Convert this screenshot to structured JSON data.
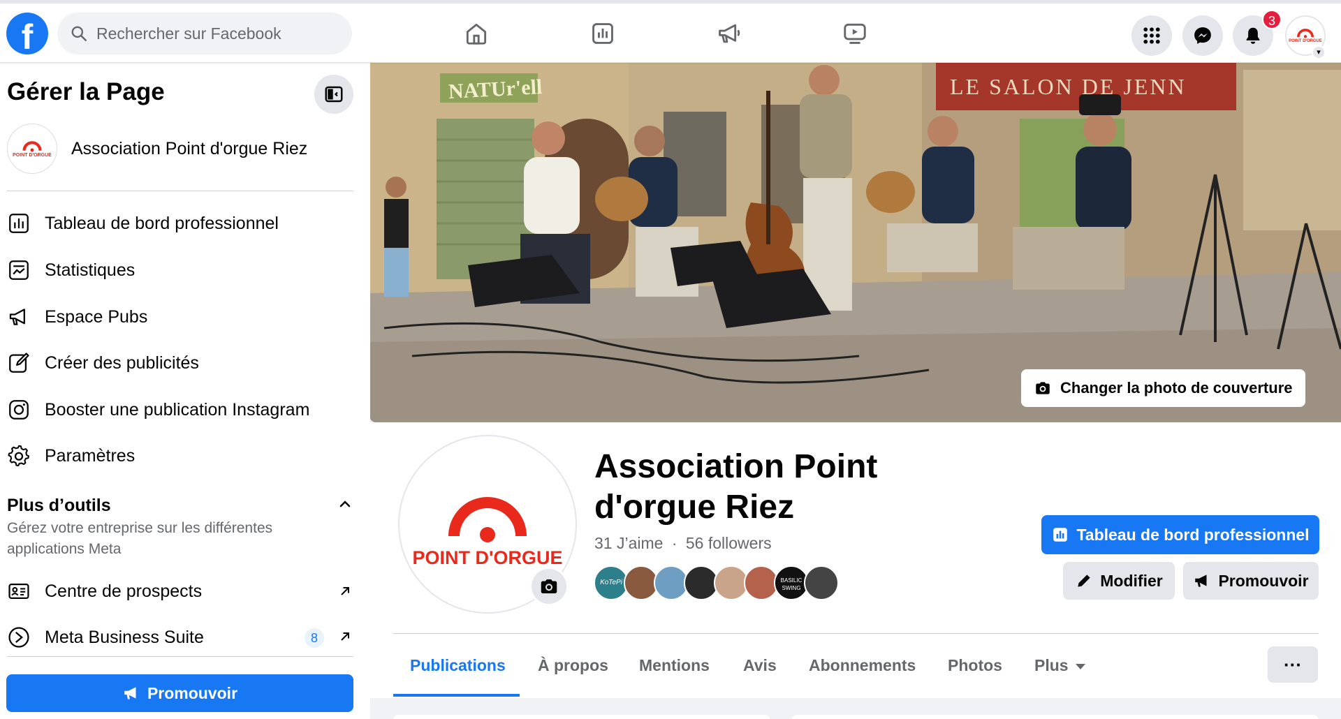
{
  "topbar": {
    "logo": "f",
    "search_placeholder": "Rechercher sur Facebook",
    "notifications_count": "3",
    "nav_icons": [
      "home-icon",
      "dashboard-icon",
      "megaphone-icon",
      "watch-icon"
    ],
    "right_icons": [
      "apps-grid-icon",
      "messenger-icon",
      "bell-icon"
    ]
  },
  "sidebar": {
    "title": "Gérer la Page",
    "page_name": "Association Point d'orgue Riez",
    "items": [
      {
        "label": "Tableau de bord professionnel",
        "icon": "dashboard-icon"
      },
      {
        "label": "Statistiques",
        "icon": "insights-icon"
      },
      {
        "label": "Espace Pubs",
        "icon": "megaphone-icon"
      },
      {
        "label": "Créer des publicités",
        "icon": "edit-icon"
      },
      {
        "label": "Booster une publication Instagram",
        "icon": "instagram-icon"
      },
      {
        "label": "Paramètres",
        "icon": "gear-icon"
      }
    ],
    "tools_heading": "Plus d’outils",
    "tools_sub": "Gérez votre entreprise sur les différentes applications Meta",
    "tools": [
      {
        "label": "Centre de prospects",
        "icon": "id-card-icon"
      },
      {
        "label": "Meta Business Suite",
        "icon": "meta-suite-icon",
        "badge": "8"
      }
    ],
    "promote_label": "Promouvoir"
  },
  "cover": {
    "change_label": "Changer la photo de couverture",
    "signs": [
      "NATUr'ell",
      "LE SALON DE JENN"
    ]
  },
  "profile": {
    "logo_text": "POINT D'ORGUE",
    "mini_logo_text": "POINT D'ORGUE",
    "name": "Association Point d'orgue Riez",
    "likes": "31 J’aime",
    "separator": "·",
    "followers": "56 followers",
    "friend_labels": [
      "KoTePi",
      "",
      "",
      "",
      "",
      "",
      "BASILIC SWING",
      ""
    ],
    "dashboard_button": "Tableau de bord professionnel",
    "edit_button": "Modifier",
    "promote_button": "Promouvoir"
  },
  "tabs": [
    {
      "label": "Publications",
      "active": true
    },
    {
      "label": "À propos"
    },
    {
      "label": "Mentions"
    },
    {
      "label": "Avis"
    },
    {
      "label": "Abonnements"
    },
    {
      "label": "Photos"
    },
    {
      "label": "Plus"
    }
  ],
  "more_button": "···",
  "colors": {
    "brand_blue": "#1877f2",
    "logo_red": "#e8291c",
    "badge_red": "#e41e3f"
  }
}
